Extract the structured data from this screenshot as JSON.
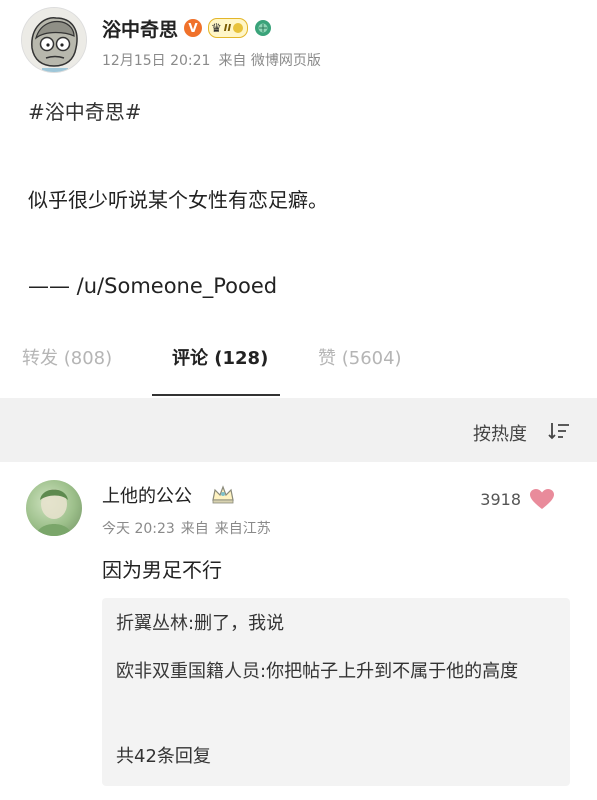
{
  "post": {
    "author": "浴中奇思",
    "level": "II",
    "time": "12月15日 20:21",
    "source": "来自 微博网页版",
    "topic": "#浴中奇思#",
    "text": "似乎很少听说某个女性有恋足癖。",
    "attribution": "—— /u/Someone_Pooed"
  },
  "tabs": {
    "repost": "转发 (808)",
    "comments": "评论 (128)",
    "likes": "赞 (5604)"
  },
  "sort": {
    "label": "按热度"
  },
  "comment": {
    "username": "上他的公公",
    "time": "今天 20:23",
    "from": "来自",
    "location": "来自江苏",
    "likes": "3918",
    "text": "因为男足不行",
    "replies": [
      {
        "name": "折翼丛林",
        "text": "删了，我说"
      },
      {
        "name": "欧非双重国籍人员",
        "text": "你把帖子上升到不属于他的高度"
      }
    ],
    "more": "共42条回复"
  },
  "colors": {
    "accent_orange": "#f0712a",
    "heart": "#e98b9b",
    "muted": "#8a8a8a",
    "sort_bar_bg": "#f1f1f1"
  },
  "icons": [
    "cartoon-avatar",
    "vip-v-icon",
    "level-crown-icon",
    "verified-globe-icon",
    "sort-icon",
    "crown-badge-icon",
    "heart-icon"
  ]
}
